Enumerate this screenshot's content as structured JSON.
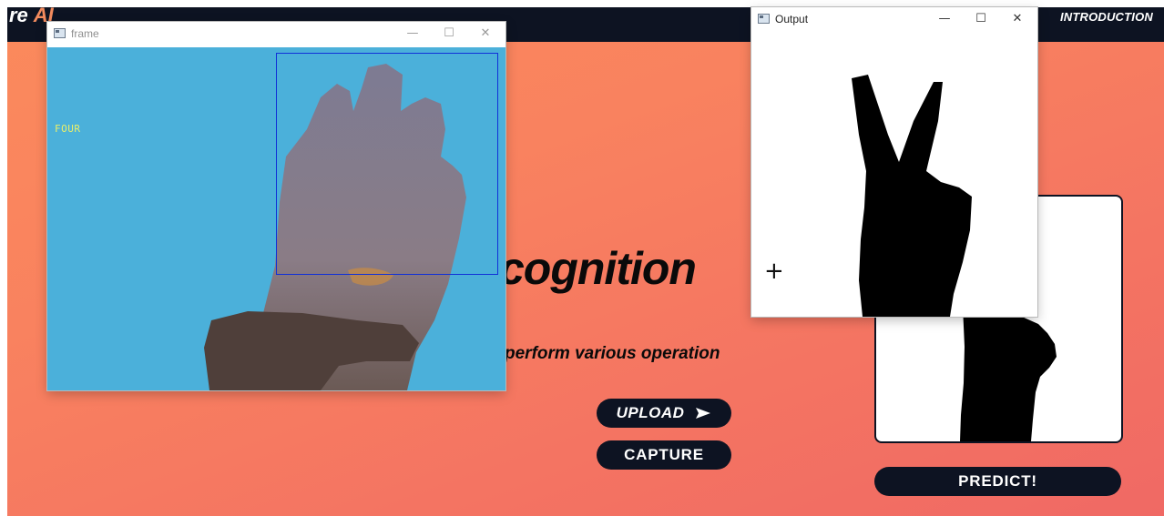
{
  "app": {
    "brand": {
      "prefix": "re",
      "ai": "AI"
    },
    "nav": {
      "introduction": "INTRODUCTION"
    }
  },
  "hero": {
    "headline": "cognition",
    "subtext": "perform various operation"
  },
  "buttons": {
    "upload": "UPLOAD",
    "capture": "CAPTURE",
    "predict": "PREDICT!"
  },
  "windows": {
    "frame": {
      "title": "frame",
      "overlay_label": "FOUR",
      "roi_color": "#1030d8",
      "overlay_color": "#e9ef6a",
      "controls": {
        "minimize": "—",
        "maximize": "☐",
        "close": "✕"
      }
    },
    "output": {
      "title": "Output",
      "controls": {
        "minimize": "—",
        "maximize": "☐",
        "close": "✕"
      }
    }
  },
  "colors": {
    "navbar": "#0d1322",
    "accent": "#f38b5e",
    "button": "#0d1322",
    "camera_bg": "#4bb0da"
  },
  "icons": {
    "upload": "send-arrow-icon",
    "window": "window-app-icon",
    "cursor": "crosshair-icon"
  }
}
